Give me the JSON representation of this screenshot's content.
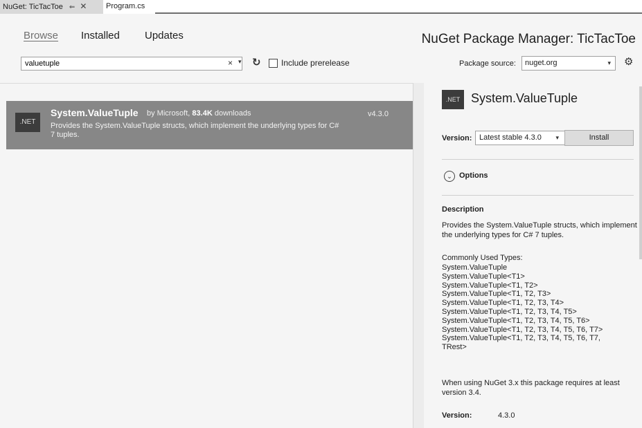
{
  "tabs": [
    {
      "label": "NuGet: TicTacToe",
      "pin": "⇐",
      "close": "✕"
    },
    {
      "label": "Program.cs"
    }
  ],
  "nav": {
    "browse": "Browse",
    "installed": "Installed",
    "updates": "Updates"
  },
  "title": "NuGet Package Manager: TicTacToe",
  "search": {
    "value": "valuetuple",
    "clear": "×",
    "dropdown": "▾"
  },
  "refresh_glyph": "↻",
  "prerelease_label": "Include prerelease",
  "package_source": {
    "label": "Package source:",
    "value": "nuget.org",
    "dropdown": "▾"
  },
  "settings_glyph": "⚙",
  "results": [
    {
      "icon_text": ".NET",
      "name": "System.ValueTuple",
      "by": "by Microsoft,",
      "downloads": "83.4K",
      "downloads_suffix": "downloads",
      "description": "Provides the System.ValueTuple structs, which implement the underlying types for C# 7 tuples.",
      "version": "v4.3.0"
    }
  ],
  "details": {
    "icon_text": ".NET",
    "name": "System.ValueTuple",
    "version_label": "Version:",
    "version_value": "Latest stable 4.3.0",
    "version_dropdown": "▾",
    "install_label": "Install",
    "options_glyph": "⌄",
    "options_label": "Options",
    "description_title": "Description",
    "description_text": "Provides the System.ValueTuple structs, which implement the underlying types for C# 7 tuples.",
    "types_title": "Commonly Used Types:",
    "types": [
      "System.ValueTuple",
      "System.ValueTuple<T1>",
      "System.ValueTuple<T1, T2>",
      "System.ValueTuple<T1, T2, T3>",
      "System.ValueTuple<T1, T2, T3, T4>",
      "System.ValueTuple<T1, T2, T3, T4, T5>",
      "System.ValueTuple<T1, T2, T3, T4, T5, T6>",
      "System.ValueTuple<T1, T2, T3, T4, T5, T6, T7>",
      "System.ValueTuple<T1, T2, T3, T4, T5, T6, T7,",
      "TRest>"
    ],
    "note": "When using NuGet 3.x this package requires at least version 3.4.",
    "bottom_version_label": "Version:",
    "bottom_version_value": "4.3.0"
  }
}
